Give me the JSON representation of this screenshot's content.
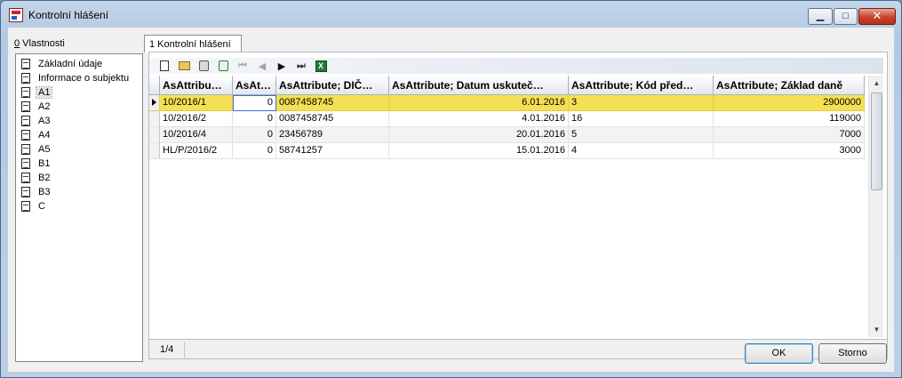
{
  "window": {
    "title": "Kontrolní hlášení"
  },
  "window_controls": {
    "minimize": "▁",
    "maximize": "□",
    "close": "✕"
  },
  "properties": {
    "label_accel": "0",
    "label_rest": " Vlastnosti",
    "items": [
      {
        "label": "Základní údaje"
      },
      {
        "label": "Informace o subjektu"
      },
      {
        "label": "A1",
        "selected": true
      },
      {
        "label": "A2"
      },
      {
        "label": "A3"
      },
      {
        "label": "A4"
      },
      {
        "label": "A5"
      },
      {
        "label": "B1"
      },
      {
        "label": "B2"
      },
      {
        "label": "B3"
      },
      {
        "label": "C"
      }
    ]
  },
  "tab": {
    "label": "1 Kontrolní hlášení"
  },
  "toolbar": {
    "new": "new-document-icon",
    "open": "open-folder-icon",
    "delete": "delete-icon",
    "refresh": "refresh-icon",
    "first": "⏮",
    "prev": "◀",
    "next": "▶",
    "last": "⏭",
    "excel": "X"
  },
  "grid": {
    "columns": [
      "AsAttribu…",
      "AsAt…",
      "AsAttribute; DIČ…",
      "AsAttribute; Datum uskuteč…",
      "AsAttribute; Kód před…",
      "AsAttribute; Základ daně"
    ],
    "rows": [
      [
        "10/2016/1",
        "0",
        "0087458745",
        "6.01.2016",
        "3",
        "2900000"
      ],
      [
        "10/2016/2",
        "0",
        "0087458745",
        "4.01.2016",
        "16",
        "119000"
      ],
      [
        "10/2016/4",
        "0",
        "23456789",
        "20.01.2016",
        "5",
        "7000"
      ],
      [
        "HL/P/2016/2",
        "0",
        "58741257",
        "15.01.2016",
        "4",
        "3000"
      ]
    ],
    "selected_row": 0
  },
  "status": {
    "count": "1/4"
  },
  "buttons": {
    "ok": "OK",
    "cancel": "Storno"
  }
}
